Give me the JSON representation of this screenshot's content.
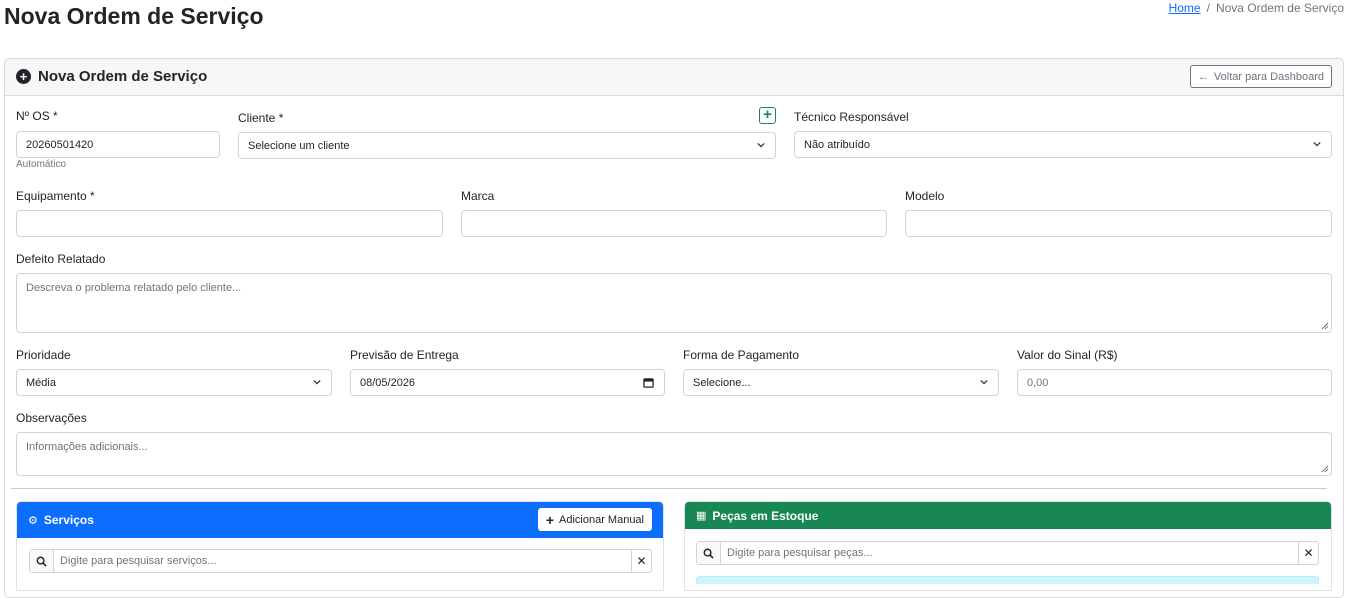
{
  "page": {
    "title": "Nova Ordem de Serviço",
    "breadcrumb": {
      "home": "Home",
      "separator": "/",
      "current": "Nova Ordem de Serviço"
    }
  },
  "card": {
    "title": "Nova Ordem de Serviço",
    "back_button": "Voltar para Dashboard"
  },
  "form": {
    "os_number": {
      "label": "Nº OS *",
      "value": "20260501420",
      "help": "Automático"
    },
    "cliente": {
      "label": "Cliente *",
      "value": "Selecione um cliente",
      "add_button": "+"
    },
    "tecnico": {
      "label": "Técnico Responsável",
      "value": "Não atribuído"
    },
    "equipamento": {
      "label": "Equipamento *",
      "value": ""
    },
    "marca": {
      "label": "Marca",
      "value": ""
    },
    "modelo": {
      "label": "Modelo",
      "value": ""
    },
    "defeito": {
      "label": "Defeito Relatado",
      "placeholder": "Descreva o problema relatado pelo cliente..."
    },
    "prioridade": {
      "label": "Prioridade",
      "value": "Média"
    },
    "previsao": {
      "label": "Previsão de Entrega",
      "value": "08/05/2026"
    },
    "pagamento": {
      "label": "Forma de Pagamento",
      "value": "Selecione..."
    },
    "sinal": {
      "label": "Valor do Sinal (R$)",
      "placeholder": "0,00"
    },
    "observacoes": {
      "label": "Observações",
      "placeholder": "Informações adicionais..."
    }
  },
  "servicos": {
    "title": "Serviços",
    "add_manual": "Adicionar Manual",
    "search_placeholder": "Digite para pesquisar serviços...",
    "color": "#0d6efd"
  },
  "pecas": {
    "title": "Peças em Estoque",
    "search_placeholder": "Digite para pesquisar peças...",
    "color": "#198754"
  }
}
